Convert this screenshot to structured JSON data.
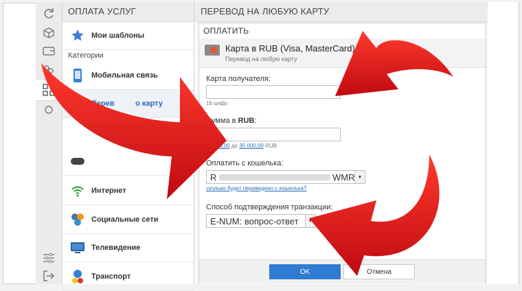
{
  "colors": {
    "accent": "#2f7bd1",
    "link": "#2a6db5",
    "arrow": "#e0141a"
  },
  "rail": {
    "icons": [
      "refresh-icon",
      "box-icon",
      "wallet-icon",
      "people-icon",
      "qr-grid-icon",
      "settings-icon",
      "sliders-icon",
      "exit-icon"
    ]
  },
  "services": {
    "header": "ОПЛАТА УСЛУГ",
    "templates_label": "Мои шаблоны",
    "categories_label": "Категории",
    "items": [
      {
        "label": "Мобильная связь",
        "icon": "phone-icon"
      },
      {
        "label": "Перев          о карту",
        "icon": "card-icon"
      },
      {
        "label": "",
        "icon": "gamepad-icon"
      },
      {
        "label": "Интернет",
        "icon": "wifi-icon"
      },
      {
        "label": "Социальные сети",
        "icon": "social-icon"
      },
      {
        "label": "Телевидение",
        "icon": "tv-icon"
      },
      {
        "label": "Транспорт",
        "icon": "transport-icon"
      }
    ]
  },
  "main": {
    "header": "ПЕРЕВОД НА ЛЮБУЮ КАРТУ",
    "dialog": {
      "title": "ОПЛАТИТЬ",
      "name": "Карта в RUB (Visa, MasterCard)",
      "subtitle": "Перевод на любую карту",
      "card_label": "Карта получателя:",
      "card_hint": "16 цифр",
      "card_value": "",
      "amount_label_prefix": "Сумма в ",
      "amount_label_bold": "RUB",
      "amount_label_suffix": ":",
      "amount_value": "",
      "amount_hint_from": "от",
      "amount_hint_min": "100,00",
      "amount_hint_to": "до",
      "amount_hint_max": "35 000,00",
      "amount_hint_cur": "RUB",
      "wallet_label": "Оплатить с кошелька:",
      "wallet_prefix": "R",
      "wallet_type": "WMR",
      "wallet_link": "сколько будет переведено с кошелька?",
      "confirm_label": "Способ подтверждения транзакции:",
      "confirm_value": "E-NUM: вопрос-ответ",
      "ok_label": "OK",
      "cancel_label": "Отмена"
    }
  }
}
